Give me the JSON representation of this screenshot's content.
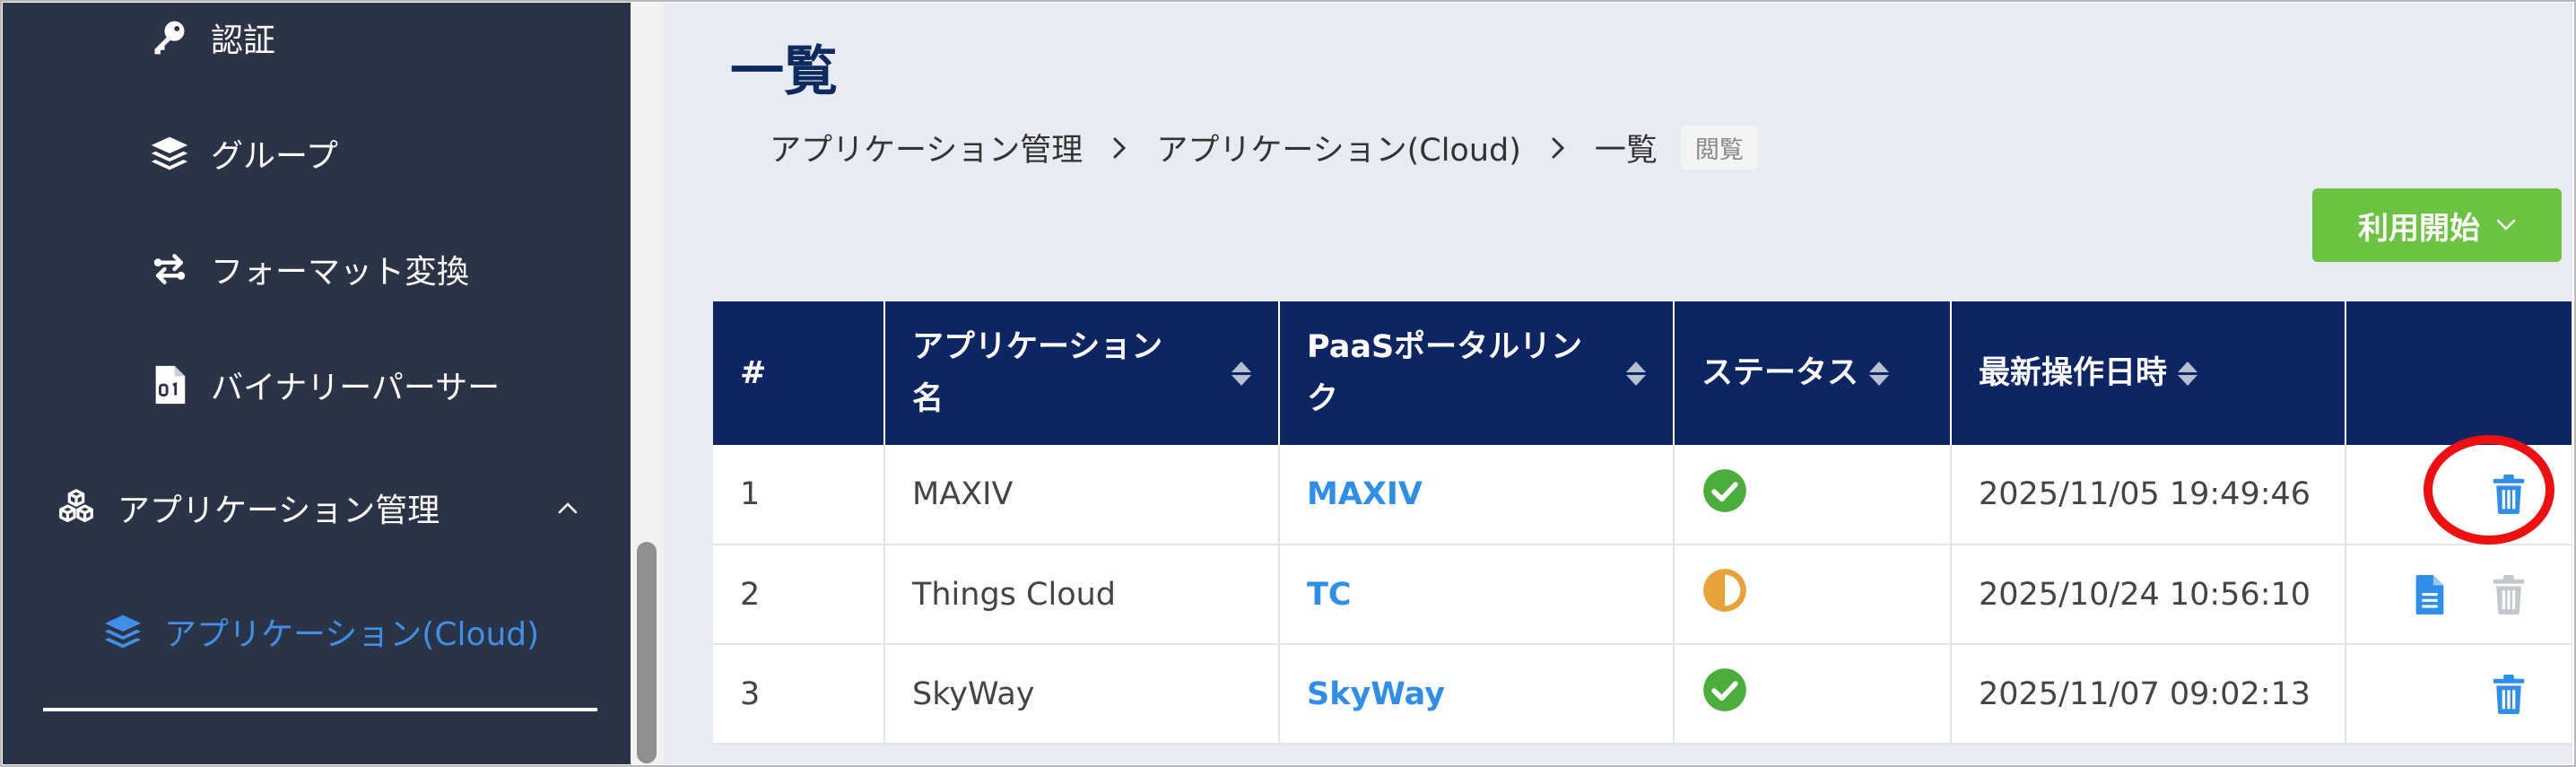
{
  "sidebar": {
    "items": [
      {
        "label": "認証",
        "icon": "key-icon"
      },
      {
        "label": "グループ",
        "icon": "layers-icon"
      },
      {
        "label": "フォーマット変換",
        "icon": "exchange-icon"
      },
      {
        "label": "バイナリーパーサー",
        "icon": "binary-file-icon"
      },
      {
        "label": "アプリケーション管理",
        "icon": "cubes-icon"
      },
      {
        "label": "アプリケーション(Cloud)",
        "icon": "layers-icon",
        "active": true
      }
    ]
  },
  "main": {
    "title": "一覧",
    "breadcrumb": [
      "アプリケーション管理",
      "アプリケーション(Cloud)",
      "一覧"
    ],
    "view_badge": "閲覧",
    "start_button": "利用開始",
    "table": {
      "headers": [
        "#",
        "アプリケーション名",
        "PaaSポータルリンク",
        "ステータス",
        "最新操作日時",
        ""
      ],
      "rows": [
        {
          "no": "1",
          "name": "MAXIV",
          "link": "MAXIV",
          "status": "ok",
          "datetime": "2025/11/05 19:49:46"
        },
        {
          "no": "2",
          "name": "Things Cloud",
          "link": "TC",
          "status": "partial",
          "datetime": "2025/10/24 10:56:10"
        },
        {
          "no": "3",
          "name": "SkyWay",
          "link": "SkyWay",
          "status": "ok",
          "datetime": "2025/11/07 09:02:13"
        }
      ]
    }
  },
  "colors": {
    "sidebar_bg": "#2b3447",
    "header_bg": "#0e2564",
    "accent_blue": "#2f8fe8",
    "success_green": "#4cae3a",
    "warning_orange": "#e8a23a",
    "button_green": "#6cc241",
    "highlight_red": "#ee1010"
  }
}
